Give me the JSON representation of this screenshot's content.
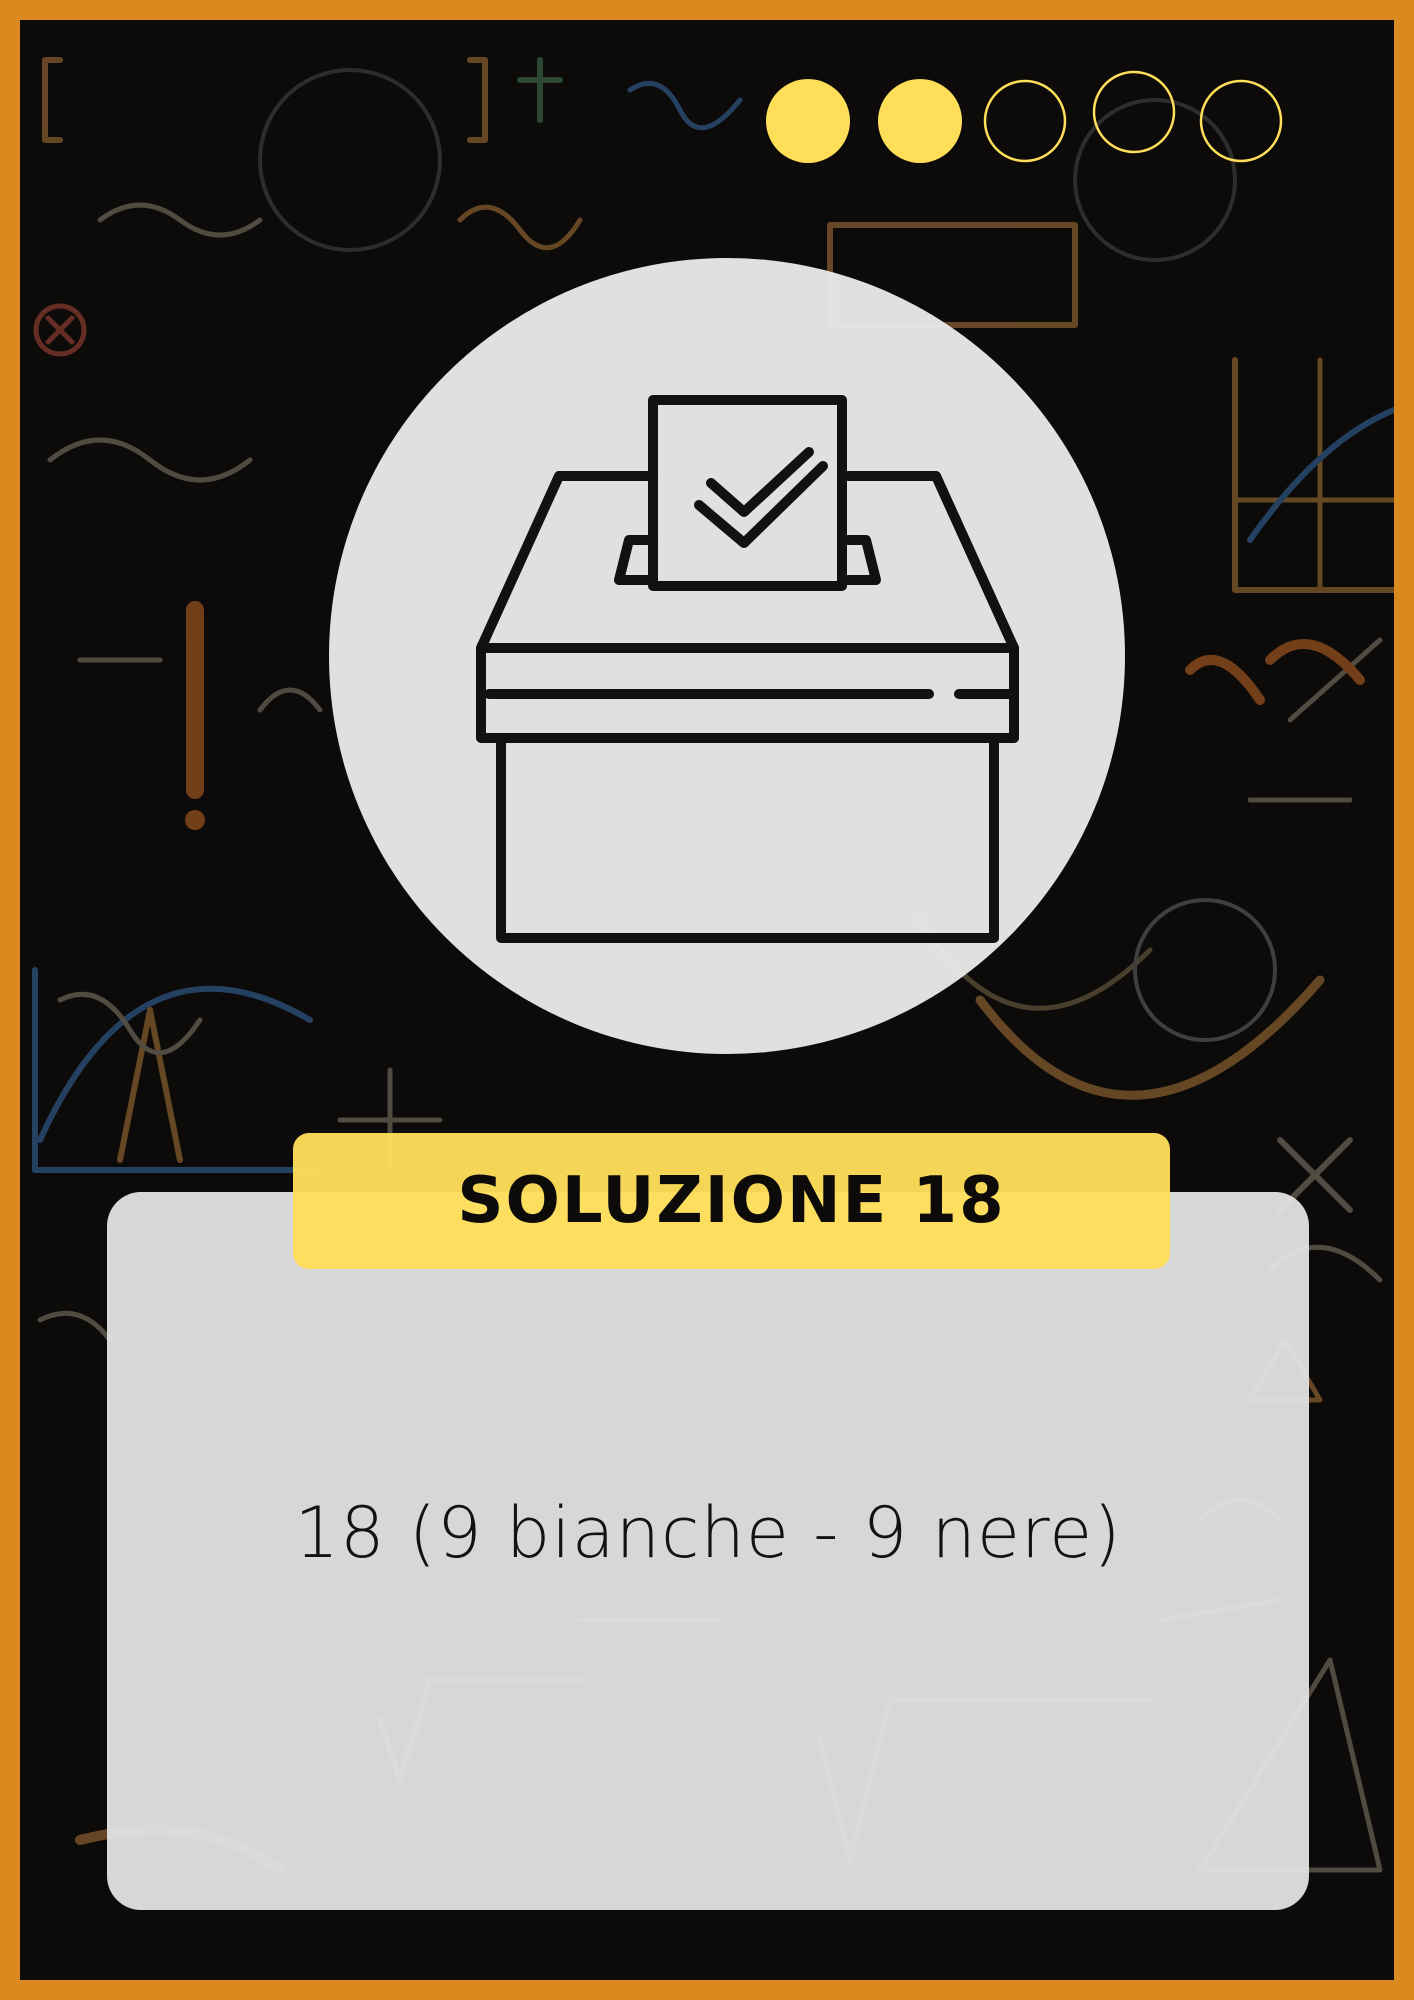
{
  "colors": {
    "frame": "#d9891d",
    "board": "#0c0b0a",
    "accent_yellow": "#ffde59",
    "panel": "#e4e4e4",
    "circle": "#ececec",
    "ink": "#121212"
  },
  "progress": {
    "total_steps": 5,
    "filled_steps": 2
  },
  "icon": {
    "name": "ballot-box-icon"
  },
  "title": "SOLUZIONE 18",
  "answer": "18 (9 bianche - 9 nere)"
}
